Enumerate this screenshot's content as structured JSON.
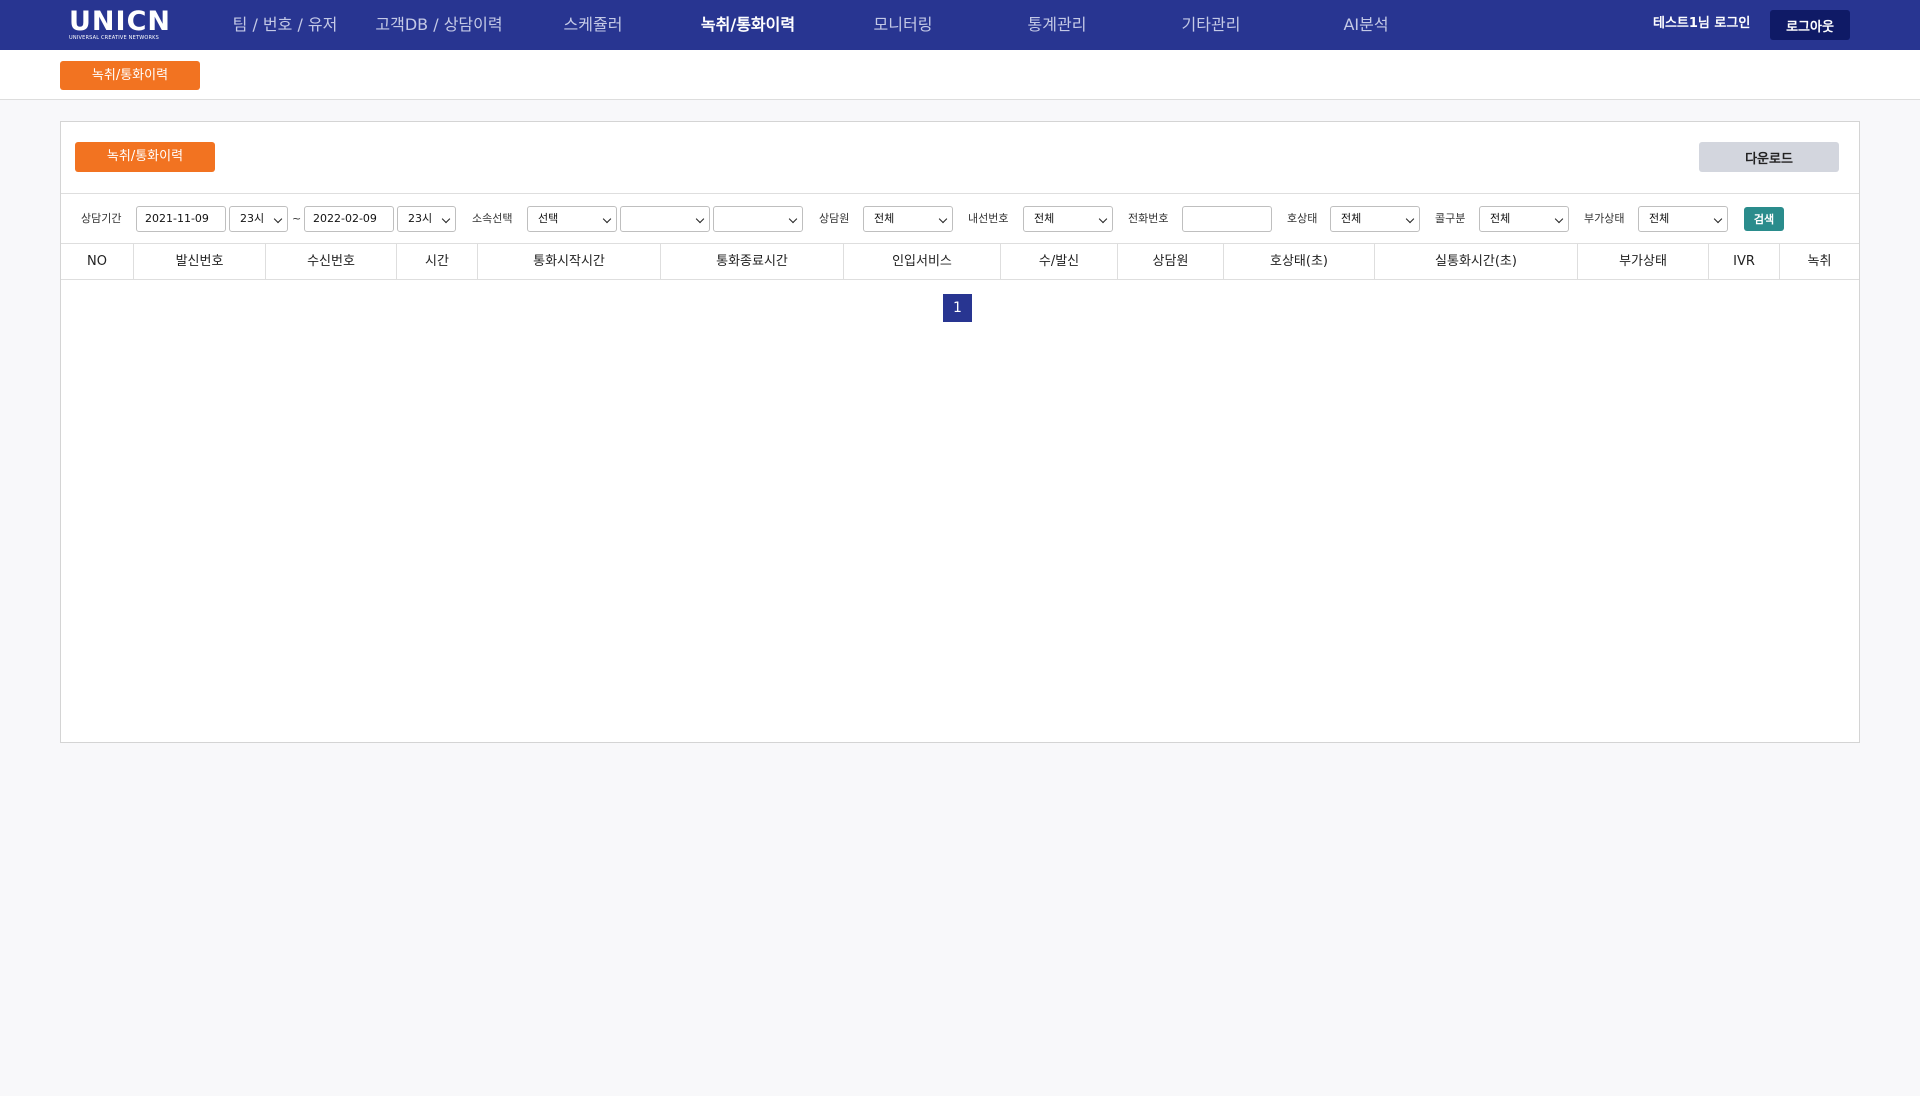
{
  "nav": {
    "logo_text": "UNICN",
    "logo_subtext": "UNIVERSAL CREATIVE NETWORKS",
    "menu": [
      {
        "label": "팀 / 번호 / 유저"
      },
      {
        "label": "고객DB / 상담이력"
      },
      {
        "label": "스케쥴러"
      },
      {
        "label": "녹취/통화이력"
      },
      {
        "label": "모니터링"
      },
      {
        "label": "통계관리"
      },
      {
        "label": "기타관리"
      },
      {
        "label": "AI분석"
      }
    ],
    "active_menu": "녹취/통화이력",
    "user_text": "테스트1님 로그인",
    "logout_label": "로그아웃"
  },
  "subbar": {
    "tag": "녹취/통화이력"
  },
  "panel": {
    "tag": "녹취/통화이력",
    "download_label": "다운로드"
  },
  "filters": {
    "period_label": "상담기간",
    "start_date": "2021-11-09",
    "start_hour": "23시",
    "range_sep": "~",
    "end_date": "2022-02-09",
    "end_hour": "23시",
    "org_label": "소속선택",
    "org_select_1": "선택",
    "org_select_2": "",
    "org_select_3": "",
    "agent_label": "상담원",
    "agent_value": "전체",
    "ext_label": "내선번호",
    "ext_value": "전체",
    "phone_label": "전화번호",
    "phone_value": "",
    "callstate_label": "호상태",
    "callstate_value": "전체",
    "calltype_label": "콜구분",
    "calltype_value": "전체",
    "extra_label": "부가상태",
    "extra_value": "전체",
    "search_label": "검색"
  },
  "table": {
    "columns": [
      "NO",
      "발신번호",
      "수신번호",
      "시간",
      "통화시작시간",
      "통화종료시간",
      "인입서비스",
      "수/발신",
      "상담원",
      "호상태(초)",
      "실통화시간(초)",
      "부가상태",
      "IVR",
      "녹취"
    ],
    "rows": []
  },
  "pagination": {
    "current": "1"
  },
  "colors": {
    "nav_bg": "#283591",
    "accent_orange": "#f27321",
    "search_teal": "#2a8c8c",
    "logout_bg": "#0f1a66"
  }
}
